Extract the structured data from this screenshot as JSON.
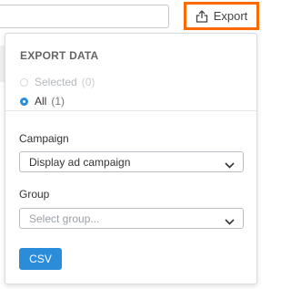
{
  "toolbar": {
    "search_value": "",
    "export_label": "Export",
    "export_icon": "share-upload-icon",
    "highlight_color": "#ff6a00"
  },
  "export_panel": {
    "title": "EXPORT DATA",
    "scope_options": [
      {
        "label": "Selected",
        "count": "(0)",
        "state": "disabled"
      },
      {
        "label": "All",
        "count": "(1)",
        "state": "checked"
      }
    ],
    "campaign": {
      "label": "Campaign",
      "value": "Display ad campaign"
    },
    "group": {
      "label": "Group",
      "placeholder": "Select group..."
    },
    "csv_label": "CSV",
    "accent_color": "#2b8cd9"
  }
}
